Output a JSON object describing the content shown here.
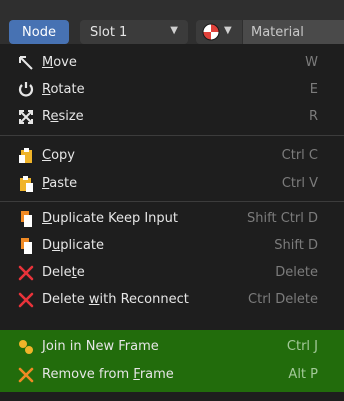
{
  "header": {
    "node_button": "Node",
    "slot_select": "Slot 1",
    "material_field": "Material"
  },
  "menu": {
    "items": [
      {
        "pre": "",
        "ul": "M",
        "post": "ove",
        "shortcut": "W",
        "icon": "move-icon"
      },
      {
        "pre": "",
        "ul": "R",
        "post": "otate",
        "shortcut": "E",
        "icon": "rotate-icon"
      },
      {
        "pre": "R",
        "ul": "e",
        "post": "size",
        "shortcut": "R",
        "icon": "resize-icon"
      },
      {
        "pre": "",
        "ul": "C",
        "post": "opy",
        "shortcut": "Ctrl C",
        "icon": "copy-icon"
      },
      {
        "pre": "",
        "ul": "P",
        "post": "aste",
        "shortcut": "Ctrl V",
        "icon": "paste-icon"
      },
      {
        "pre": "",
        "ul": "D",
        "post": "uplicate Keep Input",
        "shortcut": "Shift Ctrl D",
        "icon": "duplicate-keep-input-icon"
      },
      {
        "pre": "D",
        "ul": "u",
        "post": "plicate",
        "shortcut": "Shift D",
        "icon": "duplicate-icon"
      },
      {
        "pre": "Dele",
        "ul": "t",
        "post": "e",
        "shortcut": "Delete",
        "icon": "delete-icon"
      },
      {
        "pre": "Delete ",
        "ul": "w",
        "post": "ith Reconnect",
        "shortcut": "Ctrl Delete",
        "icon": "delete-reconnect-icon"
      },
      {
        "pre": "",
        "ul": "J",
        "post": "oin in New Frame",
        "shortcut": "Ctrl J",
        "icon": "join-frame-icon"
      },
      {
        "pre": "Remove from ",
        "ul": "F",
        "post": "rame",
        "shortcut": "Alt P",
        "icon": "remove-frame-icon"
      }
    ]
  },
  "colors": {
    "accent": "#4772b3",
    "highlight": "#226c0c",
    "menu_bg": "#1e1e1e",
    "shortcut": "#7c7c7c",
    "delete_red": "#e8333a",
    "copy_yellow": "#f0b429"
  }
}
